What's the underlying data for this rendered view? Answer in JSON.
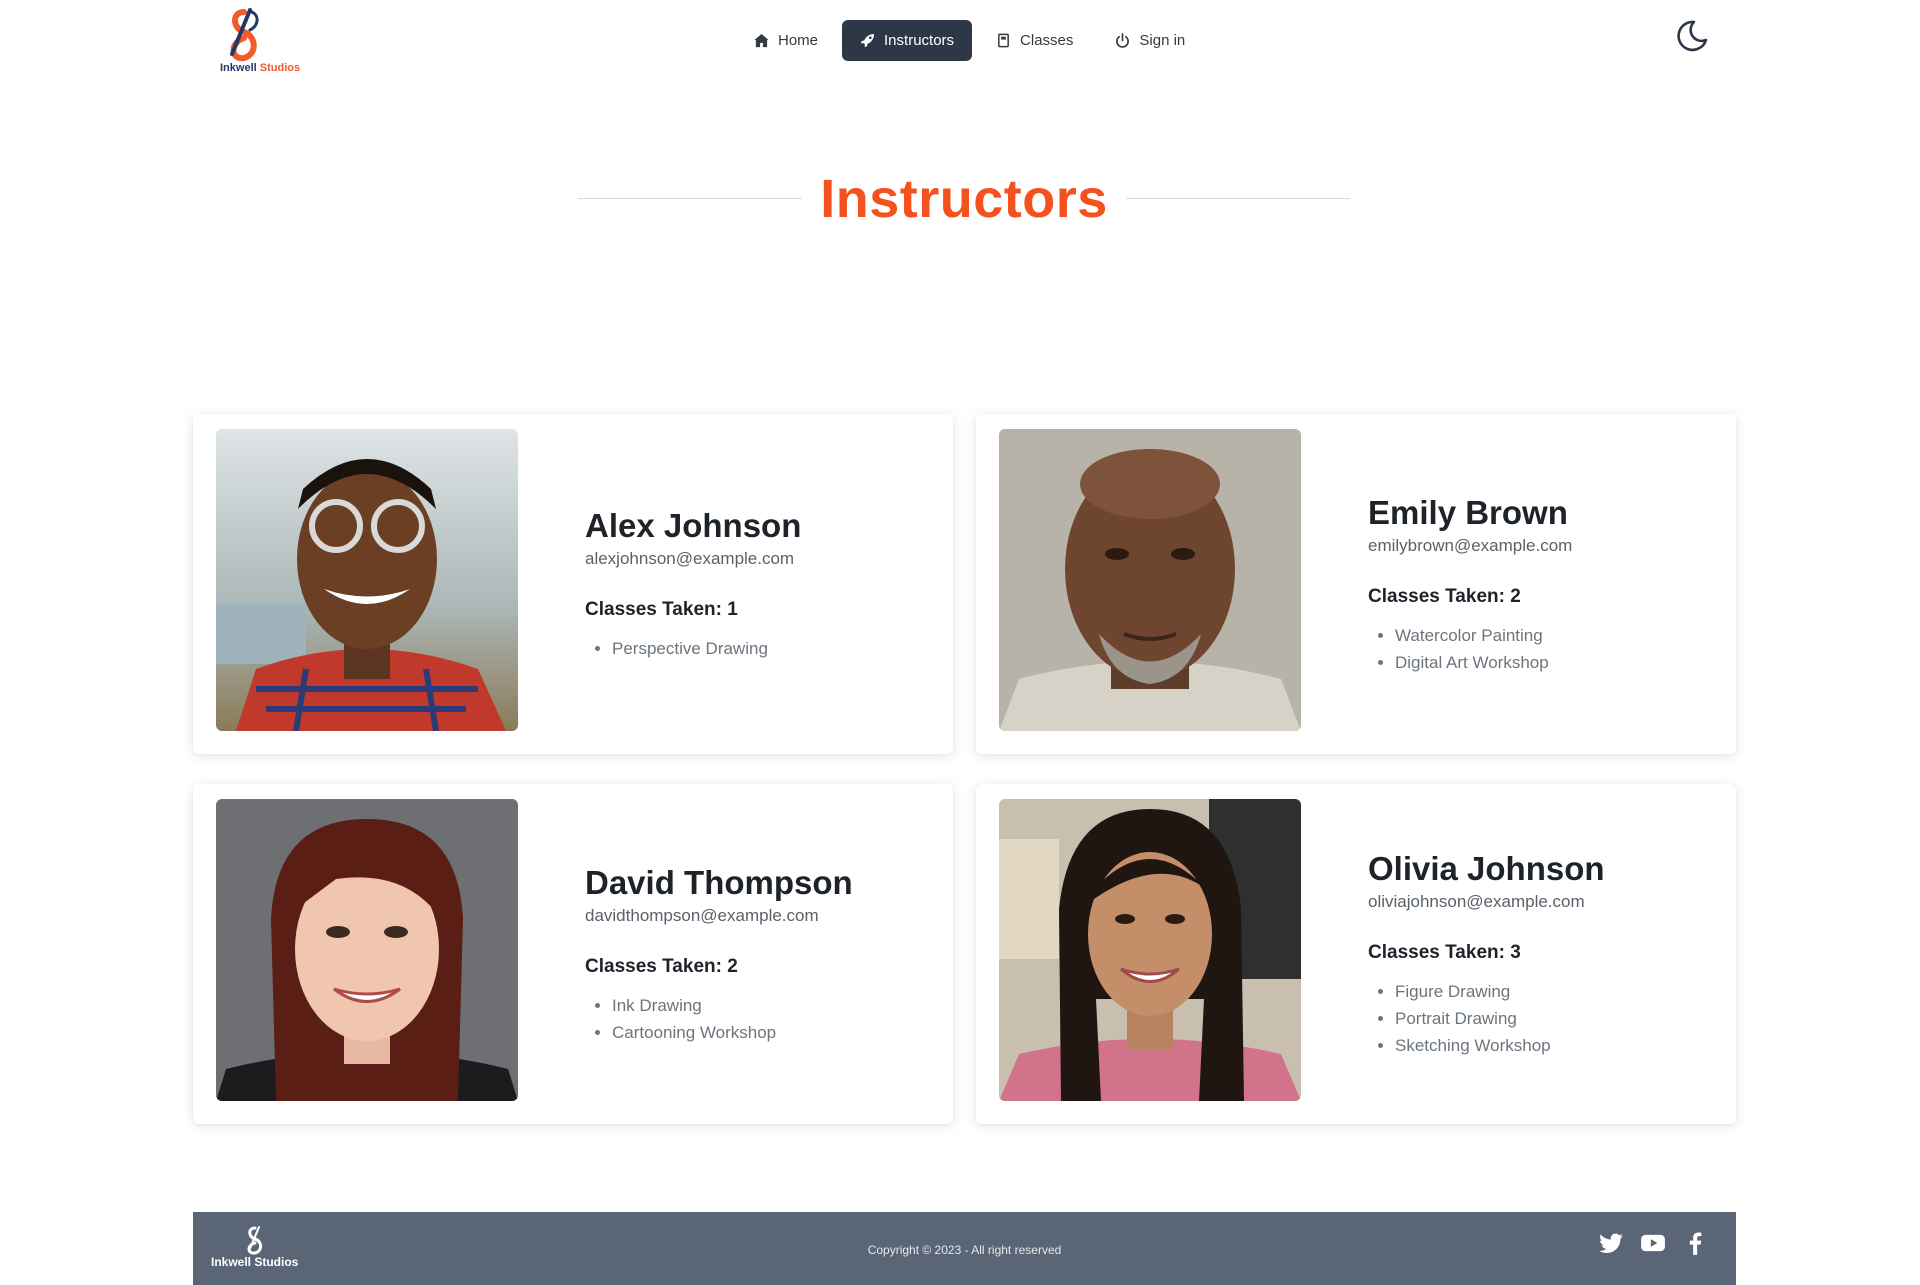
{
  "brand": {
    "name_part1": "Inkwell",
    "name_part2": "Studios",
    "footer_name": "Inkwell Studios"
  },
  "nav": {
    "items": [
      {
        "label": "Home",
        "icon": "home-icon",
        "active": false
      },
      {
        "label": "Instructors",
        "icon": "rocket-icon",
        "active": true
      },
      {
        "label": "Classes",
        "icon": "book-icon",
        "active": false
      },
      {
        "label": "Sign in",
        "icon": "power-icon",
        "active": false
      }
    ],
    "theme_toggle_icon": "moon-icon"
  },
  "page": {
    "title": "Instructors"
  },
  "instructors": [
    {
      "name": "Alex Johnson",
      "email": "alexjohnson@example.com",
      "classes_label": "Classes Taken: 1",
      "classes": [
        "Perspective Drawing"
      ]
    },
    {
      "name": "Emily Brown",
      "email": "emilybrown@example.com",
      "classes_label": "Classes Taken: 2",
      "classes": [
        "Watercolor Painting",
        "Digital Art Workshop"
      ]
    },
    {
      "name": "David Thompson",
      "email": "davidthompson@example.com",
      "classes_label": "Classes Taken: 2",
      "classes": [
        "Ink Drawing",
        "Cartooning Workshop"
      ]
    },
    {
      "name": "Olivia Johnson",
      "email": "oliviajohnson@example.com",
      "classes_label": "Classes Taken: 3",
      "classes": [
        "Figure Drawing",
        "Portrait Drawing",
        "Sketching Workshop"
      ]
    }
  ],
  "footer": {
    "copyright": "Copyright © 2023 - All right reserved",
    "socials": [
      "twitter-icon",
      "youtube-icon",
      "facebook-icon"
    ]
  },
  "colors": {
    "accent": "#f4511e",
    "nav_active": "#2d3745",
    "footer_bg": "#5a6575",
    "logo_blue": "#1f3a68"
  }
}
